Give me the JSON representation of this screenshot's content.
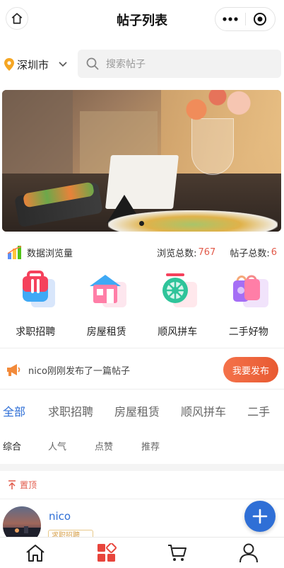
{
  "navbar": {
    "title": "帖子列表",
    "home_icon": "home-icon",
    "more_icon": "more-dots-icon",
    "close_icon": "target-icon"
  },
  "location": {
    "city": "深圳市",
    "icon": "location-pin-icon"
  },
  "search": {
    "placeholder": "搜索帖子"
  },
  "stats": {
    "label": "数据浏览量",
    "views_label": "浏览总数:",
    "views_value": "767",
    "posts_label": "帖子总数:",
    "posts_value": "6",
    "accent_color": "#e25a4a"
  },
  "categories": [
    {
      "label": "求职招聘",
      "icon": "job-bag-icon"
    },
    {
      "label": "房屋租赁",
      "icon": "house-icon"
    },
    {
      "label": "顺风拼车",
      "icon": "wheel-icon"
    },
    {
      "label": "二手好物",
      "icon": "secondhand-bag-icon"
    }
  ],
  "notice": {
    "text": "nico刚刚发布了一篇帖子",
    "button": "我要发布",
    "icon": "megaphone-icon"
  },
  "tabs": [
    {
      "label": "全部",
      "active": true
    },
    {
      "label": "求职招聘",
      "active": false
    },
    {
      "label": "房屋租赁",
      "active": false
    },
    {
      "label": "顺风拼车",
      "active": false
    },
    {
      "label": "二手",
      "active": false
    }
  ],
  "subtabs": [
    {
      "label": "综合",
      "active": true
    },
    {
      "label": "人气",
      "active": false
    },
    {
      "label": "点赞",
      "active": false
    },
    {
      "label": "推荐",
      "active": false
    }
  ],
  "pinned": {
    "label": "置顶"
  },
  "post": {
    "author": "nico",
    "tag": "求职招聘"
  },
  "tabbar": [
    {
      "icon": "home-outline-icon",
      "active": false
    },
    {
      "icon": "category-grid-icon",
      "active": true
    },
    {
      "icon": "cart-icon",
      "active": false
    },
    {
      "icon": "user-icon",
      "active": false
    }
  ],
  "colors": {
    "primary_blue": "#2f6fd6",
    "accent_orange": "#e85a32",
    "accent_red": "#e25a4a"
  }
}
